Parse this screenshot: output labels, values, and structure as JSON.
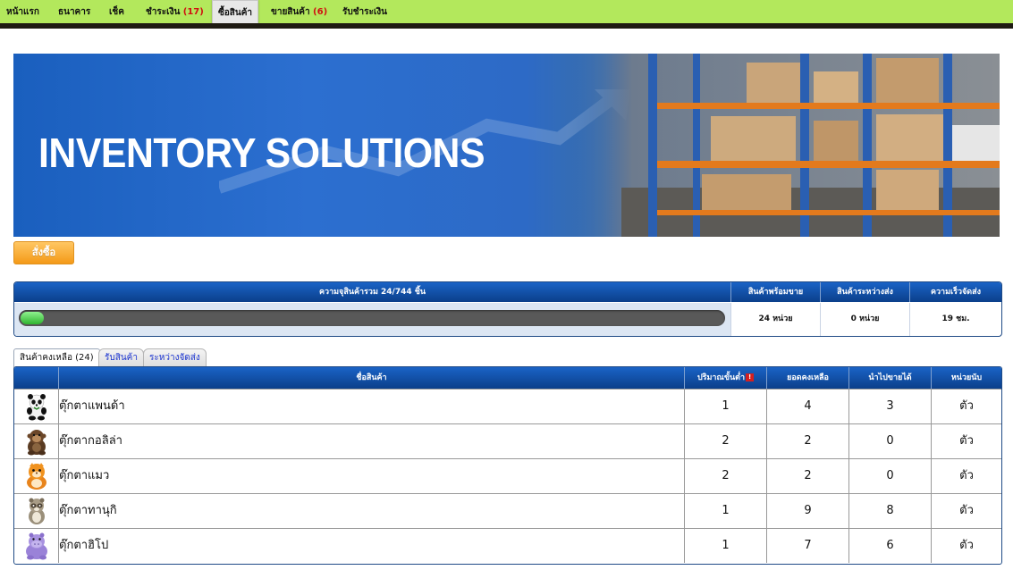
{
  "nav": {
    "items": [
      {
        "label": "หน้าแรก"
      },
      {
        "label": "ธนาคาร"
      },
      {
        "label": "เช็ค"
      },
      {
        "label": "ชำระเงิน",
        "count": "(17)"
      },
      {
        "label": "ซื้อสินค้า"
      },
      {
        "label": "ขายสินค้า",
        "count": "(6)"
      },
      {
        "label": "รับชำระเงิน"
      }
    ],
    "active_index": 4
  },
  "banner": {
    "title": "INVENTORY SOLUTIONS"
  },
  "order_button": {
    "label": "สั่งซื้อ"
  },
  "summary": {
    "capacity_label": "ความจุสินค้ารวม 24/744 ชิ้น",
    "capacity_fraction": 0.0323,
    "headers": [
      "สินค้าพร้อมขาย",
      "สินค้าระหว่างส่ง",
      "ความเร็วจัดส่ง"
    ],
    "values": [
      "24 หน่วย",
      "0 หน่วย",
      "19 ชม."
    ]
  },
  "tabs": [
    {
      "label": "สินค้าคงเหลือ (24)",
      "active": true
    },
    {
      "label": "รับสินค้า",
      "active": false
    },
    {
      "label": "ระหว่างจัดส่ง",
      "active": false
    }
  ],
  "table": {
    "headers": [
      "ชื่อสินค้า",
      "ปริมาณขั้นต่ำ",
      "ยอดคงเหลือ",
      "นำไปขายได้",
      "หน่วยนับ"
    ],
    "min_qty_warning_glyph": "!",
    "rows": [
      {
        "icon": "panda-doll-icon",
        "name": "ตุ๊กตาแพนด้า",
        "min": "1",
        "stock": "4",
        "sellable": "3",
        "unit": "ตัว"
      },
      {
        "icon": "gorilla-doll-icon",
        "name": "ตุ๊กตากอลิล่า",
        "min": "2",
        "stock": "2",
        "sellable": "0",
        "unit": "ตัว"
      },
      {
        "icon": "cat-doll-icon",
        "name": "ตุ๊กตาแมว",
        "min": "2",
        "stock": "2",
        "sellable": "0",
        "unit": "ตัว"
      },
      {
        "icon": "tanuki-doll-icon",
        "name": "ตุ๊กตาทานุกิ",
        "min": "1",
        "stock": "9",
        "sellable": "8",
        "unit": "ตัว"
      },
      {
        "icon": "hippo-doll-icon",
        "name": "ตุ๊กตาฮิโป",
        "min": "1",
        "stock": "7",
        "sellable": "6",
        "unit": "ตัว"
      }
    ]
  }
}
